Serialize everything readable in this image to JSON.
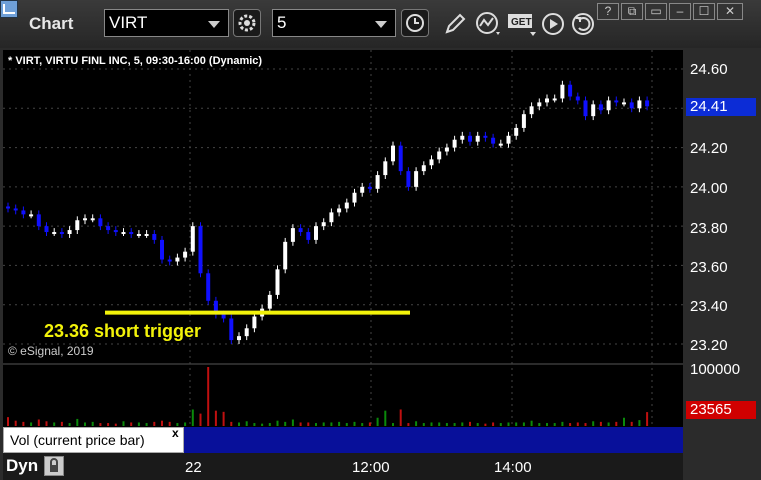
{
  "window": {
    "title": "Chart"
  },
  "toolbar": {
    "symbol_value": "VIRT",
    "interval_value": "5"
  },
  "chart": {
    "header": "* VIRT, VIRTU FINL INC, 5, 09:30-16:00 (Dynamic)",
    "watermark": "© eSignal, 2019",
    "annotation": "23.36 short trigger",
    "price_ticks": [
      "24.60",
      "24.40",
      "24.20",
      "24.00",
      "23.80",
      "23.60",
      "23.40",
      "23.20"
    ],
    "last_price": "24.41",
    "volume_tick": "100000",
    "last_volume": "23565",
    "volume_study_label": "Vol (current price bar)",
    "volume_close": "x",
    "time_ticks": [
      "22",
      "12:00",
      "14:00"
    ],
    "mode_label": "Dyn"
  },
  "colors": {
    "up": "#ffffff",
    "down": "#1010ff",
    "trigger_line": "#f2f20a",
    "price_badge": "#0c2cd6",
    "volume_badge": "#d00000",
    "volume_up": "#0a8a0a",
    "volume_down": "#c01010"
  },
  "chart_data": {
    "type": "candlestick",
    "title": "VIRT, VIRTU FINL INC, 5, 09:30-16:00 (Dynamic)",
    "ylim": [
      23.15,
      24.7
    ],
    "trigger_price": 23.36,
    "close": [
      23.89,
      23.88,
      23.86,
      23.86,
      23.8,
      23.77,
      23.77,
      23.76,
      23.78,
      23.83,
      23.84,
      23.84,
      23.8,
      23.78,
      23.77,
      23.77,
      23.76,
      23.76,
      23.76,
      23.73,
      23.63,
      23.62,
      23.64,
      23.67,
      23.8,
      23.56,
      23.42,
      23.35,
      23.33,
      23.22,
      23.24,
      23.28,
      23.34,
      23.38,
      23.45,
      23.58,
      23.72,
      23.79,
      23.77,
      23.73,
      23.8,
      23.82,
      23.87,
      23.89,
      23.92,
      23.97,
      24.0,
      23.99,
      24.06,
      24.13,
      24.21,
      24.08,
      24.0,
      24.08,
      24.11,
      24.14,
      24.18,
      24.2,
      24.24,
      24.26,
      24.23,
      24.26,
      24.25,
      24.22,
      24.22,
      24.26,
      24.3,
      24.37,
      24.41,
      24.43,
      24.45,
      24.45,
      24.52,
      24.46,
      24.44,
      24.36,
      24.42,
      24.39,
      24.44,
      24.43,
      24.43,
      24.4,
      24.44,
      24.41
    ],
    "volume": [
      15000,
      9000,
      7000,
      6000,
      11000,
      8000,
      6000,
      7000,
      5000,
      12000,
      6000,
      7000,
      5000,
      5000,
      4000,
      8000,
      6000,
      6000,
      5000,
      7000,
      9000,
      7000,
      5000,
      6000,
      28000,
      21000,
      100000,
      26000,
      24000,
      7000,
      6000,
      8000,
      5000,
      4000,
      5000,
      9000,
      7000,
      11000,
      6000,
      6000,
      5000,
      6000,
      6000,
      7000,
      5000,
      7000,
      5000,
      6000,
      14000,
      26000,
      5000,
      28000,
      5000,
      8000,
      5000,
      6000,
      6000,
      5000,
      5000,
      6000,
      7000,
      5000,
      4000,
      6000,
      5000,
      6000,
      6000,
      6000,
      9000,
      5000,
      5000,
      5000,
      7000,
      5000,
      6000,
      5000,
      8000,
      7000,
      6000,
      7000,
      14000,
      7000,
      10000,
      23565
    ]
  }
}
